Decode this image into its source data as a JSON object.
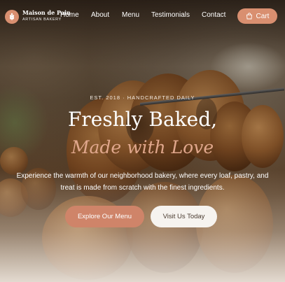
{
  "brand": {
    "name": "Maison de Pain",
    "tagline": "ARTISAN BAKERY",
    "logo_icon": "wheat-icon",
    "accent_color": "#d98f70"
  },
  "nav": {
    "links": [
      {
        "label": "Home"
      },
      {
        "label": "About"
      },
      {
        "label": "Menu"
      },
      {
        "label": "Testimonials"
      },
      {
        "label": "Contact"
      }
    ],
    "cart_label": "Cart",
    "cart_icon": "shopping-bag-icon"
  },
  "hero": {
    "eyebrow": "EST. 2018 · HANDCRAFTED DAILY",
    "headline_line1": "Freshly Baked,",
    "headline_line2": "Made with Love",
    "description": "Experience the warmth of our neighborhood bakery, where every loaf, pastry, and treat is made from scratch with the finest ingredients.",
    "primary_cta": "Explore Our Menu",
    "secondary_cta": "Visit Us Today",
    "background_image": "bagels-on-rod-photo"
  }
}
